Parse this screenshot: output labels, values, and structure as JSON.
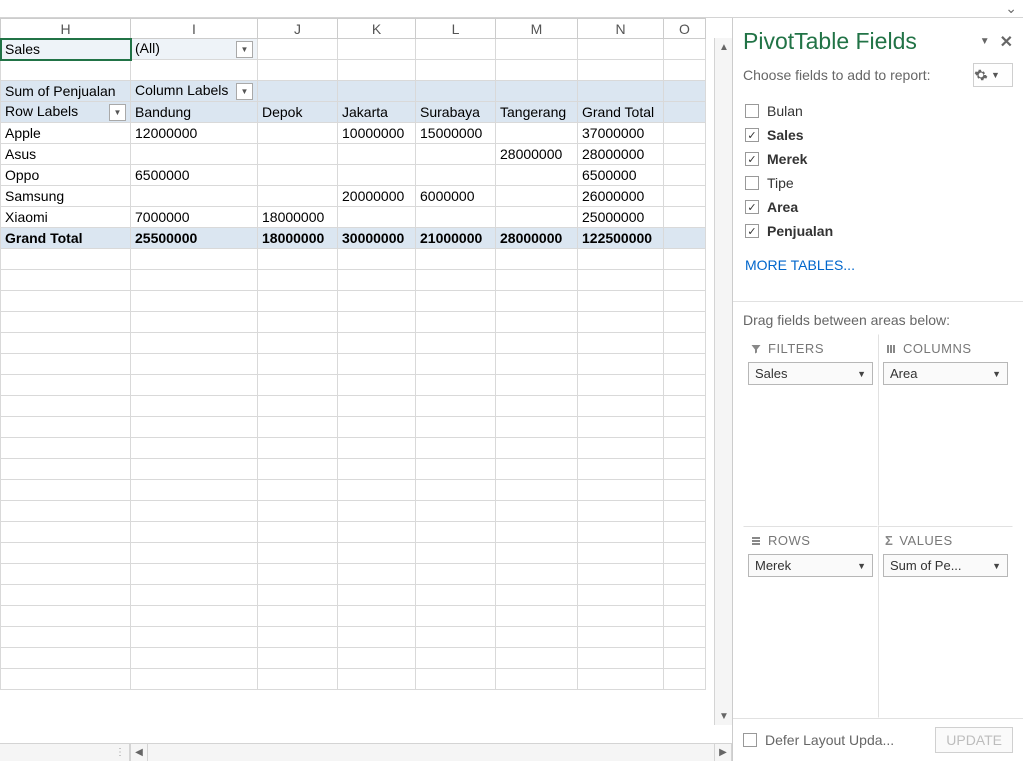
{
  "columns": [
    "H",
    "I",
    "J",
    "K",
    "L",
    "M",
    "N",
    "O"
  ],
  "filter": {
    "label": "Sales",
    "value": "(All)"
  },
  "pivot": {
    "summary_label": "Sum of Penjualan",
    "col_labels_label": "Column Labels",
    "row_labels_label": "Row Labels",
    "column_headers": [
      "Bandung",
      "Depok",
      "Jakarta",
      "Surabaya",
      "Tangerang",
      "Grand Total"
    ],
    "rows": [
      {
        "label": "Apple",
        "v": [
          "12000000",
          "",
          "10000000",
          "15000000",
          "",
          "37000000"
        ]
      },
      {
        "label": "Asus",
        "v": [
          "",
          "",
          "",
          "",
          "28000000",
          "28000000"
        ]
      },
      {
        "label": "Oppo",
        "v": [
          "6500000",
          "",
          "",
          "",
          "",
          "6500000"
        ]
      },
      {
        "label": "Samsung",
        "v": [
          "",
          "",
          "20000000",
          "6000000",
          "",
          "26000000"
        ]
      },
      {
        "label": "Xiaomi",
        "v": [
          "7000000",
          "18000000",
          "",
          "",
          "",
          "25000000"
        ]
      }
    ],
    "grand_total_label": "Grand Total",
    "grand_total": [
      "25500000",
      "18000000",
      "30000000",
      "21000000",
      "28000000",
      "122500000"
    ]
  },
  "panel": {
    "title": "PivotTable Fields",
    "subtitle": "Choose fields to add to report:",
    "fields": [
      {
        "label": "Bulan",
        "checked": false
      },
      {
        "label": "Sales",
        "checked": true
      },
      {
        "label": "Merek",
        "checked": true
      },
      {
        "label": "Tipe",
        "checked": false
      },
      {
        "label": "Area",
        "checked": true
      },
      {
        "label": "Penjualan",
        "checked": true
      }
    ],
    "more_tables": "MORE TABLES...",
    "areas_label": "Drag fields between areas below:",
    "areas": {
      "filters": {
        "label": "FILTERS",
        "chip": "Sales"
      },
      "columns": {
        "label": "COLUMNS",
        "chip": "Area"
      },
      "rows": {
        "label": "ROWS",
        "chip": "Merek"
      },
      "values": {
        "label": "VALUES",
        "chip": "Sum of Pe..."
      }
    },
    "defer": "Defer Layout Upda...",
    "update": "UPDATE"
  }
}
